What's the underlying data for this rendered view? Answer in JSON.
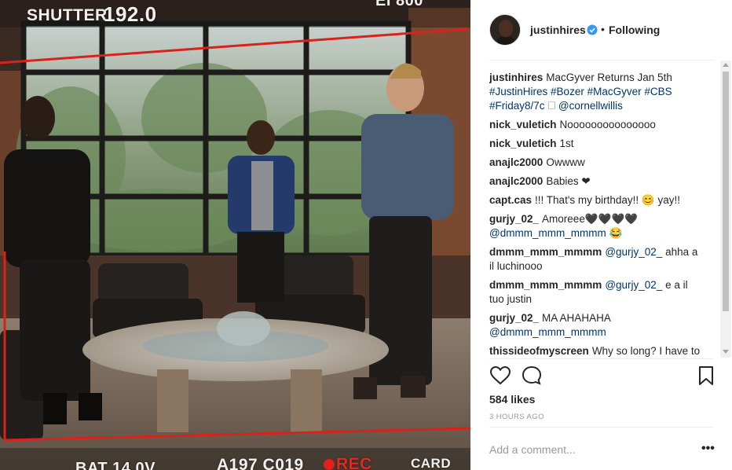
{
  "viewfinder": {
    "shutter_label": "SHUTTER",
    "shutter_value": "192.0",
    "ei_partial": "EI 800",
    "bat": "BAT 14.0V",
    "clip": "A197 C019",
    "rec": "REC",
    "card": "CARD"
  },
  "header": {
    "username": "justinhires",
    "separator": "•",
    "follow_status": "Following"
  },
  "comments": [
    {
      "user": "justinhires",
      "segments": [
        {
          "t": "MacGyver Returns Jan 5th "
        },
        {
          "t": "#JustinHires",
          "tag": true
        },
        {
          "t": " "
        },
        {
          "t": "#Bozer",
          "tag": true
        },
        {
          "t": " "
        },
        {
          "t": "#MacGyver",
          "tag": true
        },
        {
          "t": " "
        },
        {
          "t": "#CBS",
          "tag": true
        },
        {
          "t": " "
        },
        {
          "t": "#Friday8/7c",
          "tag": true
        },
        {
          "t": " 🗆 "
        },
        {
          "t": "@cornellwillis",
          "tag": true
        }
      ]
    },
    {
      "user": "nick_vuletich",
      "segments": [
        {
          "t": "Nooooooooooooooo"
        }
      ]
    },
    {
      "user": "nick_vuletich",
      "segments": [
        {
          "t": "1st"
        }
      ]
    },
    {
      "user": "anajlc2000",
      "segments": [
        {
          "t": "Owwww"
        }
      ]
    },
    {
      "user": "anajlc2000",
      "segments": [
        {
          "t": "Babies ❤"
        }
      ]
    },
    {
      "user": "capt.cas",
      "segments": [
        {
          "t": "!!! That's my birthday!! 😊 yay!!"
        }
      ]
    },
    {
      "user": "gurjy_02_",
      "segments": [
        {
          "t": "Amoreee🖤🖤🖤🖤 "
        },
        {
          "t": "@dmmm_mmm_mmmm",
          "tag": true
        },
        {
          "t": " 😂"
        }
      ]
    },
    {
      "user": "dmmm_mmm_mmmm",
      "segments": [
        {
          "t": "@gurjy_02_",
          "tag": true
        },
        {
          "t": " ahha a il luchinooo"
        }
      ]
    },
    {
      "user": "dmmm_mmm_mmmm",
      "segments": [
        {
          "t": "@gurjy_02_",
          "tag": true
        },
        {
          "t": " e a il tuo justin"
        }
      ]
    },
    {
      "user": "gurjy_02_",
      "segments": [
        {
          "t": "MA AHAHAHA "
        },
        {
          "t": "@dmmm_mmm_mmmm",
          "tag": true
        }
      ]
    },
    {
      "user": "thissideofmyscreen",
      "segments": [
        {
          "t": "Why so long? I have to"
        }
      ]
    }
  ],
  "likes": "584 likes",
  "time": "3 HOURS AGO",
  "add_comment": {
    "placeholder": "Add a comment..."
  },
  "more": "•••",
  "colors": {
    "link": "#003569",
    "verified": "#3897f0",
    "rec": "#e02a20"
  }
}
